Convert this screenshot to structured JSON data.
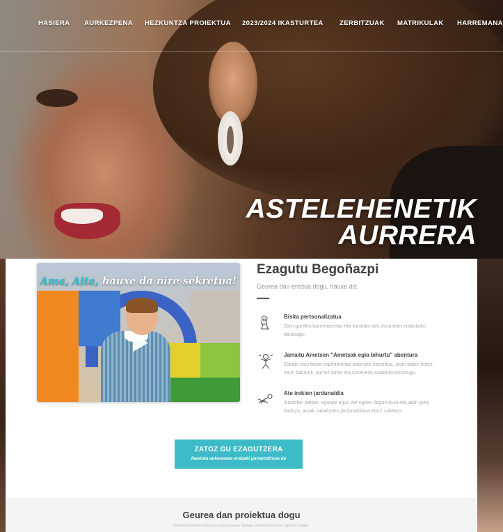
{
  "nav": {
    "items": [
      {
        "label": "HASIERA"
      },
      {
        "label": "AURKEZPENA"
      },
      {
        "label": "HEZKUNTZA PROIEKTUA"
      },
      {
        "label": "2023/2024 IKASTURTEA"
      },
      {
        "label": "ZERBITZUAK"
      },
      {
        "label": "MATRIKULAK"
      },
      {
        "label": "HARREMANA"
      }
    ]
  },
  "hero": {
    "line1": "ASTELEHENETIK",
    "line2": "AURRERA"
  },
  "video": {
    "headline_part1": "Ama, Aita,",
    "headline_part2": " hauxe da nire sekretua!",
    "play_icon": "play-icon"
  },
  "intro": {
    "title": "Ezagutu Begoñazpi",
    "subtitle": "Geurea dan eredua dogu, hauxe da:"
  },
  "features": [
    {
      "icon": "stroller-icon",
      "title": "Bisita pertsonalizatua",
      "desc": "Zarri gurekin harremanetan eta ikastola nahi dozunean erakutsiko deutsugu."
    },
    {
      "icon": "dreamer-child-icon",
      "title": "Jarraitu Ametsen \"Ametsak egia bihurtu\" abentura",
      "desc": "Eskatu eizu bisita experimental bateruko hitzordua. Ipuin baten bidez, zeuri bakarrik, aurrez aurre eta zuzenean azalduko deutsugu."
    },
    {
      "icon": "flying-child-icon",
      "title": "Ate irekien jardunaldia",
      "desc": "Ikastolan bertan, egunez egun zer egiten dogun ikusi eta jakin gura badozu, atoak zabaltzeko jardunalditara etorri zaitekez."
    }
  ],
  "cta": {
    "label": "ZATOZ GU EZAGUTZERA",
    "sublabel": "Ikastola aukeratzea erabaki garrantzitsua da"
  },
  "project": {
    "title": "Geurea dan proiektua dogu",
    "desc": "Begoñazpi Ikastolan hezkuntza proiektu propioa daukagu, etorkizuneko herritar laguntzen dabilgu."
  }
}
